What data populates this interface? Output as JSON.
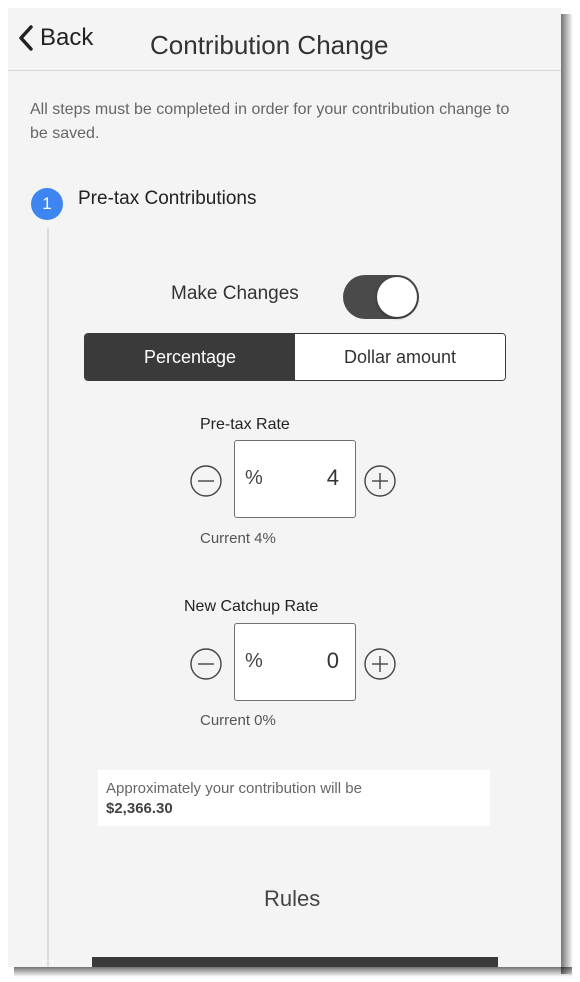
{
  "header": {
    "back_label": "Back",
    "title": "Contribution Change"
  },
  "intro": {
    "text": "All steps must be completed in order for your contribution change to be saved."
  },
  "step": {
    "number": "1",
    "label": "Pre-tax Contributions"
  },
  "make_changes": {
    "label": "Make Changes",
    "toggle_on": true
  },
  "segmented": {
    "options": [
      "Percentage",
      "Dollar amount"
    ],
    "selected": "Percentage"
  },
  "pretax_rate": {
    "title": "Pre-tax Rate",
    "unit": "%",
    "value": "4",
    "current": "Current 4%",
    "decrement_icon": "minus-circle-icon",
    "increment_icon": "plus-circle-icon"
  },
  "catchup_rate": {
    "title": "New Catchup Rate",
    "unit": "%",
    "value": "0",
    "current": "Current 0%",
    "decrement_icon": "minus-circle-icon",
    "increment_icon": "plus-circle-icon"
  },
  "estimate": {
    "line1": "Approximately your contribution will be",
    "amount": "$2,366.30"
  },
  "rules": {
    "label": "Rules"
  },
  "colors": {
    "accent": "#3d85f0",
    "dark": "#3a3a3a",
    "background": "#f4f4f4"
  }
}
